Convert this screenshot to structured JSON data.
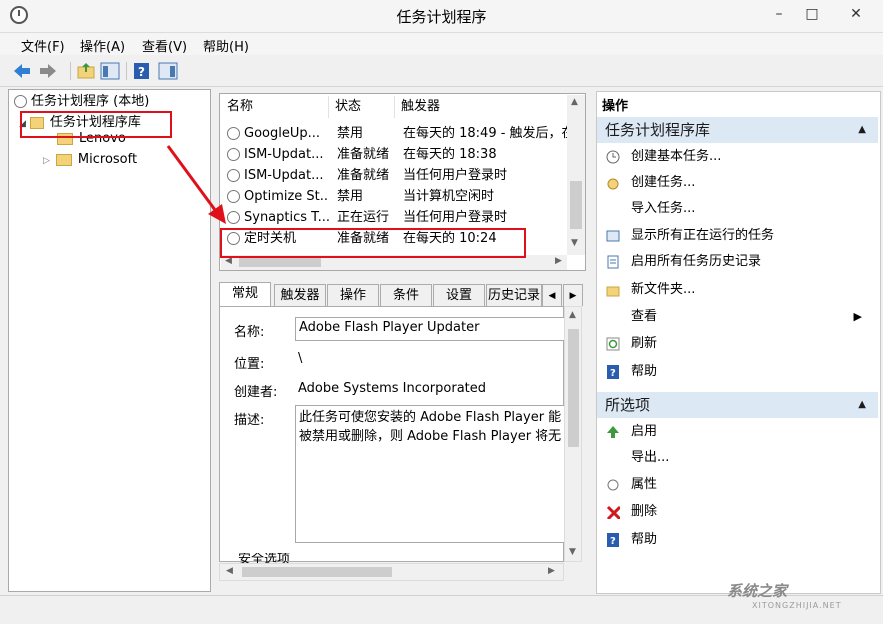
{
  "window": {
    "title": "任务计划程序"
  },
  "menu": [
    "文件(F)",
    "操作(A)",
    "查看(V)",
    "帮助(H)"
  ],
  "tree": {
    "root": "任务计划程序 (本地)",
    "library": "任务计划程序库",
    "children": [
      "Lenovo",
      "Microsoft"
    ]
  },
  "task_list": {
    "columns": [
      "名称",
      "状态",
      "触发器"
    ],
    "rows": [
      {
        "name": "GoogleUp...",
        "status": "禁用",
        "trigger": "在每天的 18:49 - 触发后，在"
      },
      {
        "name": "ISM-Updat...",
        "status": "准备就绪",
        "trigger": "在每天的 18:38"
      },
      {
        "name": "ISM-Updat...",
        "status": "准备就绪",
        "trigger": "当任何用户登录时"
      },
      {
        "name": "Optimize St...",
        "status": "禁用",
        "trigger": "当计算机空闲时"
      },
      {
        "name": "Synaptics T...",
        "status": "正在运行",
        "trigger": "当任何用户登录时"
      },
      {
        "name": "定时关机",
        "status": "准备就绪",
        "trigger": "在每天的 10:24"
      }
    ]
  },
  "tabs": [
    "常规",
    "触发器",
    "操作",
    "条件",
    "设置",
    "历史记录"
  ],
  "general": {
    "name_label": "名称:",
    "name_value": "Adobe Flash Player Updater",
    "location_label": "位置:",
    "location_value": "\\",
    "author_label": "创建者:",
    "author_value": "Adobe Systems Incorporated",
    "desc_label": "描述:",
    "desc_line1": "此任务可使您安装的 Adobe Flash Player 能",
    "desc_line2": "被禁用或删除，则 Adobe Flash Player 将无",
    "security_label": "安全选项"
  },
  "actions_pane": {
    "header": "操作",
    "section1": "任务计划程序库",
    "items1": [
      "创建基本任务...",
      "创建任务...",
      "导入任务...",
      "显示所有正在运行的任务",
      "启用所有任务历史记录",
      "新文件夹...",
      "查看",
      "刷新",
      "帮助"
    ],
    "section2": "所选项",
    "items2": [
      "启用",
      "导出...",
      "属性",
      "删除",
      "帮助"
    ]
  },
  "watermark": {
    "text": "系统之家",
    "sub": "XITONGZHIJIA.NET"
  },
  "colors": {
    "highlight": "#e0101a",
    "section_bg": "#dde8f5"
  }
}
